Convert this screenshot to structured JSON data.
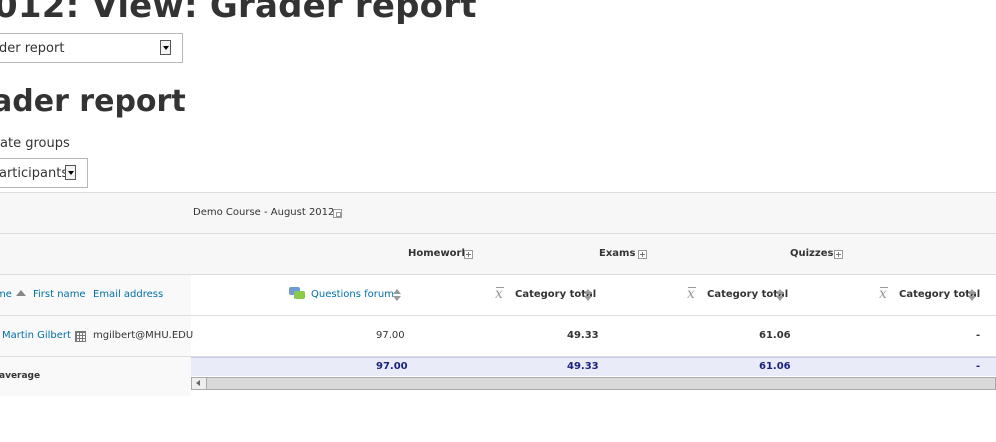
{
  "page": {
    "title": "012: View: Grader report",
    "report_select_value": "der report",
    "section_heading": "ader report",
    "groups_label": "ate groups",
    "groups_select_value": "articipants"
  },
  "grader": {
    "course_header": "Demo Course - August 2012",
    "categories": [
      "Homework",
      "Exams",
      "Quizzes"
    ],
    "columns": {
      "last_name": "me",
      "first_name": "First name",
      "email": "Email address",
      "forum": "Questions forum",
      "cat_total": "Category total"
    },
    "student": {
      "name": "Martin Gilbert",
      "email": "mgilbert@MHU.EDU",
      "forum": "97.00",
      "homework_total": "49.33",
      "exams_total": "61.06",
      "quizzes_total": "-"
    },
    "average": {
      "label": "average",
      "forum": "97.00",
      "homework_total": "49.33",
      "exams_total": "61.06",
      "quizzes_total": "-"
    }
  },
  "colors": {
    "link": "#0070a8",
    "average_bg": "#e9ecf8",
    "average_text": "#1a237e"
  },
  "icons": [
    "sort-up-icon",
    "sort-icon",
    "forum-icon",
    "mean-x-bar-icon",
    "expand-icon",
    "collapse-icon",
    "user-report-icon",
    "scroll-left-icon"
  ]
}
